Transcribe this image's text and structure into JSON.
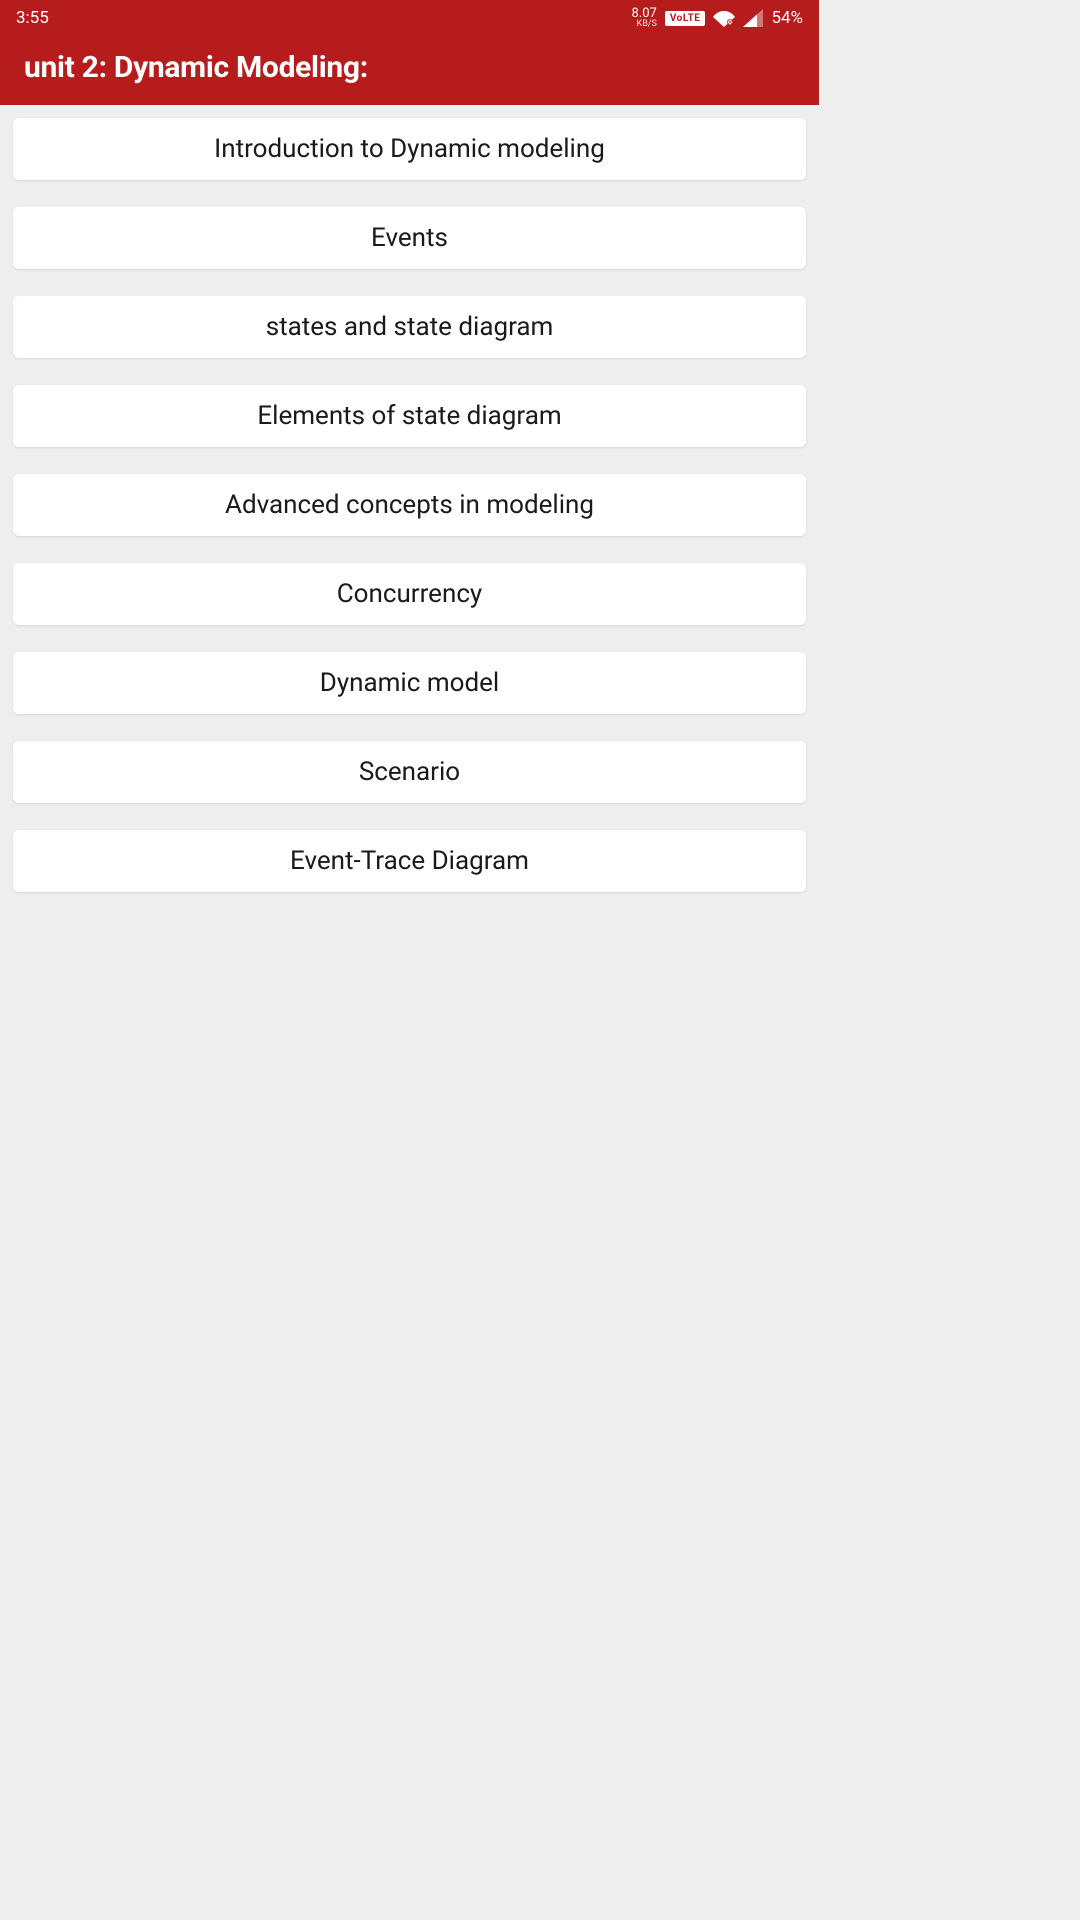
{
  "statusBar": {
    "time": "3:55",
    "dataRateValue": "8.07",
    "dataRateUnit": "KB/S",
    "volteLabel": "VoLTE",
    "batteryPercent": "54%"
  },
  "appBar": {
    "title": "unit 2: Dynamic Modeling:"
  },
  "topics": [
    {
      "label": "Introduction to Dynamic modeling"
    },
    {
      "label": "Events"
    },
    {
      "label": "states and state diagram"
    },
    {
      "label": "Elements of state diagram"
    },
    {
      "label": "Advanced concepts in modeling"
    },
    {
      "label": "Concurrency"
    },
    {
      "label": "Dynamic model"
    },
    {
      "label": "Scenario"
    },
    {
      "label": "Event-Trace Diagram"
    }
  ]
}
